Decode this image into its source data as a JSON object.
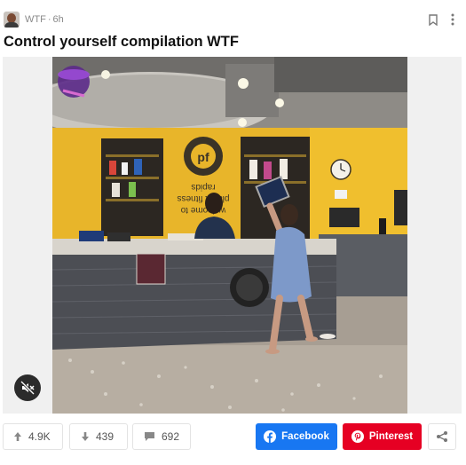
{
  "post": {
    "channel": "WTF",
    "separator": "·",
    "age": "6h",
    "title": "Control yourself compilation WTF"
  },
  "video": {
    "scene_sign_text": "welcome to\nplanet fitness\nrapids",
    "muted": true
  },
  "actions": {
    "upvotes": "4.9K",
    "downvotes": "439",
    "comments": "692",
    "facebook_label": "Facebook",
    "pinterest_label": "Pinterest"
  },
  "colors": {
    "facebook": "#1877f2",
    "pinterest": "#e60023",
    "wall_yellow": "#e8b52a"
  },
  "icons": [
    "bookmark-icon",
    "more-vertical-icon",
    "mute-icon",
    "arrow-up-icon",
    "arrow-down-icon",
    "comment-icon",
    "facebook-icon",
    "pinterest-icon",
    "share-icon"
  ]
}
